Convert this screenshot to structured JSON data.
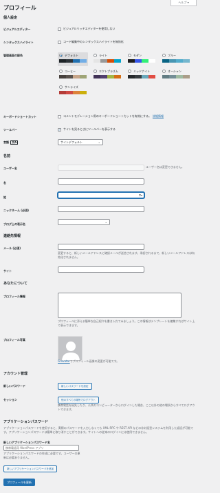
{
  "help_tab": "ヘルプ ▾",
  "page_title": "プロフィール",
  "personal": {
    "heading": "個人設定",
    "visual_editor_label": "ビジュアルエディター",
    "visual_editor_text": "ビジュアルリッチエディターを使用しない",
    "syntax_label": "シンタックスハイライト",
    "syntax_text": "コード編集中のシンタックスハイライトを無効化",
    "color_scheme_label": "管理画面の配色",
    "schemes": [
      {
        "name": "デフォルト",
        "colors": [
          "#1d2327",
          "#2c3338",
          "#2271b1",
          "#72aee6"
        ]
      },
      {
        "name": "ライト",
        "colors": [
          "#e5e5e5",
          "#999999",
          "#d64e07",
          "#04a4cc"
        ]
      },
      {
        "name": "モダン",
        "colors": [
          "#1e1e1e",
          "#3858e9",
          "#33f078",
          "#ffffff"
        ]
      },
      {
        "name": "ブルー",
        "colors": [
          "#096484",
          "#4796b3",
          "#52accc",
          "#74b6ce"
        ]
      },
      {
        "name": "コーヒー",
        "colors": [
          "#46403c",
          "#59524c",
          "#c7a589",
          "#9ea476"
        ]
      },
      {
        "name": "エクトプラズム",
        "colors": [
          "#413256",
          "#523f6d",
          "#a3b745",
          "#d46f15"
        ]
      },
      {
        "name": "ミッドナイト",
        "colors": [
          "#25282b",
          "#363b3f",
          "#69a8bb",
          "#e14d43"
        ]
      },
      {
        "name": "オーシャン",
        "colors": [
          "#627c83",
          "#738e96",
          "#9ebaa0",
          "#aa9d88"
        ]
      },
      {
        "name": "サンライズ",
        "colors": [
          "#b43c38",
          "#cf4944",
          "#dd823b",
          "#ccaf0b"
        ]
      }
    ],
    "shortcut_label": "キーボードショートカット",
    "shortcut_text": "コメントモデレーション用のキーボードショートカットを有効にする。",
    "shortcut_link": "詳細情報",
    "toolbar_label": "ツールバー",
    "toolbar_text": "サイトを見るときにツールバーを表示する",
    "language_label": "言語",
    "language_value": "サイトデフォルト"
  },
  "name": {
    "heading": "名前",
    "username_label": "ユーザー名",
    "username_note": "ユーザー名は変更できません。",
    "first_label": "名",
    "last_label": "姓",
    "nickname_label": "ニックネーム (必須)",
    "display_label": "ブログ上の表示名"
  },
  "contact": {
    "heading": "連絡先情報",
    "email_label": "メール (必須)",
    "email_desc": "変更すると、新しいメールアドレスに確認メールが送信されます。承認されるまで、新しいメールアドレスは有効化されません。",
    "site_label": "サイト"
  },
  "about": {
    "heading": "あなたについて",
    "bio_label": "プロフィール情報",
    "bio_desc": "プロフィールに添える簡単な自己紹介を書き入れてみましょう。この情報はテンプレートを編集すればサイト上で表示できます。",
    "photo_label": "プロフィール写真",
    "gravatar_link": "Gravatar",
    "gravatar_text": "でプロフィール画像の変更が可能です。"
  },
  "account": {
    "heading": "アカウント管理",
    "new_password_label": "新しいパスワード",
    "new_password_button": "新しいパスワードを設定",
    "sessions_label": "セッション",
    "sessions_button": "他のすべての場所でログアウト",
    "sessions_desc": "携帯電話を紛失したり、公共のコンピューターからログインした場合、ここ以外の他の場所からすべてログアウトできます。"
  },
  "app_passwords": {
    "heading": "アプリケーションパスワード",
    "desc": "アプリケーションパスワードを使用すると、実際のパスワードを入力しなくても XML-RPC や REST API などの非対話型システムを利用した認証が可能です。アプリケーションパスワードは簡単に取り消すことができます。サイトへの従来のログインには使用できません。",
    "new_label": "新しいアプリケーションパスワード名",
    "placeholder": "携帯電話用 WordPress アプリ",
    "name_desc": "アプリケーションパスワードの作成に必要です。ユーザーの更新は必要ありません。",
    "add_button": "新しいアプリケーションパスワードを追加"
  },
  "submit_button": "プロフィールを更新"
}
